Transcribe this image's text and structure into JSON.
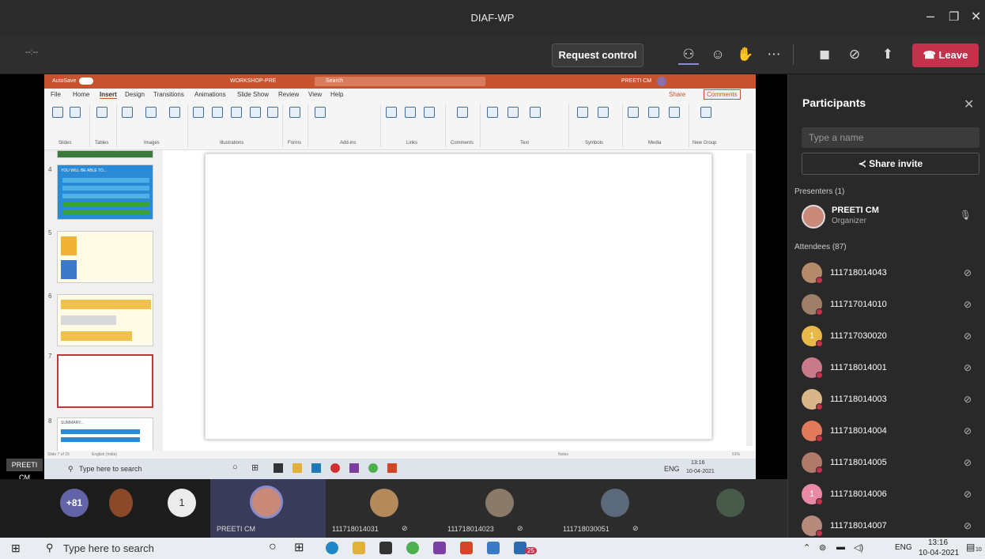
{
  "window": {
    "title": "DIAF-WP",
    "timer": "--:--"
  },
  "toolbar": {
    "request_control": "Request control",
    "leave": "Leave"
  },
  "ppt": {
    "title": "WORKSHOP-PRE",
    "autosave": "AutoSave",
    "search": "Search",
    "user": "PREETI CM",
    "tabs": [
      "File",
      "Home",
      "Insert",
      "Design",
      "Transitions",
      "Animations",
      "Slide Show",
      "Review",
      "View",
      "Help"
    ],
    "share": "Share",
    "comments": "Comments",
    "groups": [
      "Slides",
      "Tables",
      "Images",
      "Illustrations",
      "Forms",
      "Add-ins",
      "Links",
      "Comments",
      "Text",
      "Symbols",
      "Media",
      "New Group"
    ],
    "slide_status": "Slide 7 of 15",
    "language": "English (India)",
    "notes": "Notes",
    "zoom": "61%",
    "thumb_labels": [
      "YOU WILL BE ABLE TO...",
      "SUMMARY..."
    ],
    "thumb_numbers": [
      "4",
      "5",
      "6",
      "7",
      "8"
    ]
  },
  "presenter_tag": "PREETI CM",
  "inner_taskbar": {
    "search": "Type here to search",
    "time": "13:16",
    "date": "10-04-2021",
    "lang": "ENG"
  },
  "panel": {
    "title": "Participants",
    "search_placeholder": "Type a name",
    "share_invite": "Share invite",
    "presenters_label": "Presenters (1)",
    "attendees_label": "Attendees (87)",
    "presenter": {
      "name": "PREETI CM",
      "role": "Organizer"
    },
    "attendees": [
      "111718014043",
      "111717014010",
      "111717030020",
      "111718014001",
      "111718014003",
      "111718014004",
      "111718014005",
      "111718014006",
      "111718014007"
    ]
  },
  "tiles": {
    "more": "+81",
    "one": "1",
    "labels": [
      "PREETI CM",
      "111718014031",
      "111718014023",
      "111718030051"
    ]
  },
  "taskbar": {
    "search": "Type here to search",
    "lang": "ENG",
    "time": "13:16",
    "date": "10-04-2021",
    "badge": "25",
    "notif": "10"
  }
}
